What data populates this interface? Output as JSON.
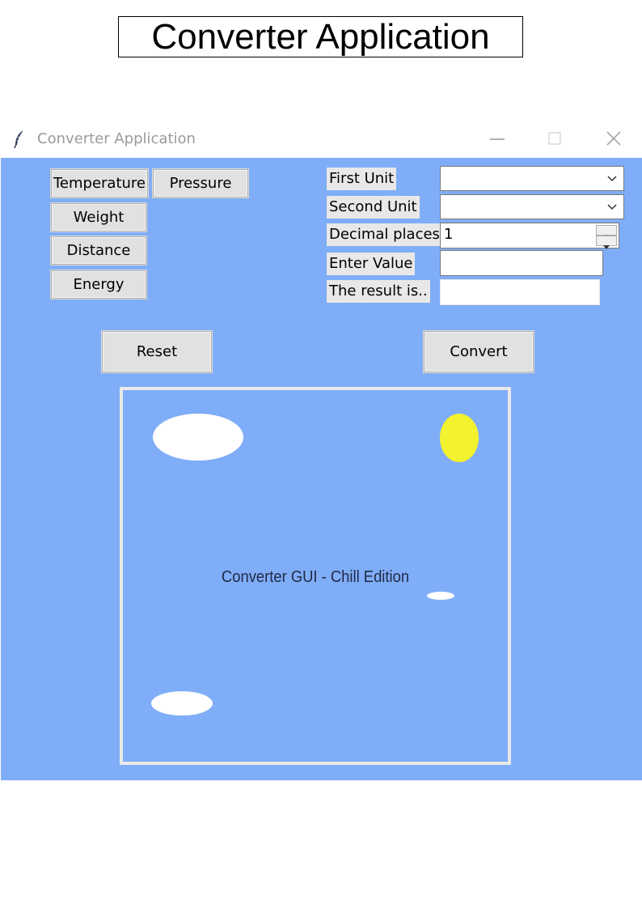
{
  "page": {
    "heading": "Converter Application"
  },
  "window": {
    "title": "Converter Application",
    "controls": [
      "minimize",
      "maximize",
      "close"
    ]
  },
  "categories": {
    "temperature": "Temperature",
    "pressure": "Pressure",
    "weight": "Weight",
    "distance": "Distance",
    "energy": "Energy"
  },
  "form": {
    "first_unit_label": "First Unit",
    "first_unit_value": "",
    "second_unit_label": "Second Unit",
    "second_unit_value": "",
    "decimal_places_label": "Decimal places",
    "decimal_places_value": "1",
    "enter_value_label": "Enter Value",
    "enter_value_value": "",
    "result_label": "The result is..",
    "result_value": ""
  },
  "actions": {
    "reset": "Reset",
    "convert": "Convert"
  },
  "canvas": {
    "caption": "Converter GUI - Chill Edition",
    "background_color": "#80adf7",
    "sun_color": "#f2f22e",
    "cloud_color": "#ffffff"
  },
  "colors": {
    "client_background": "#80adf7"
  }
}
